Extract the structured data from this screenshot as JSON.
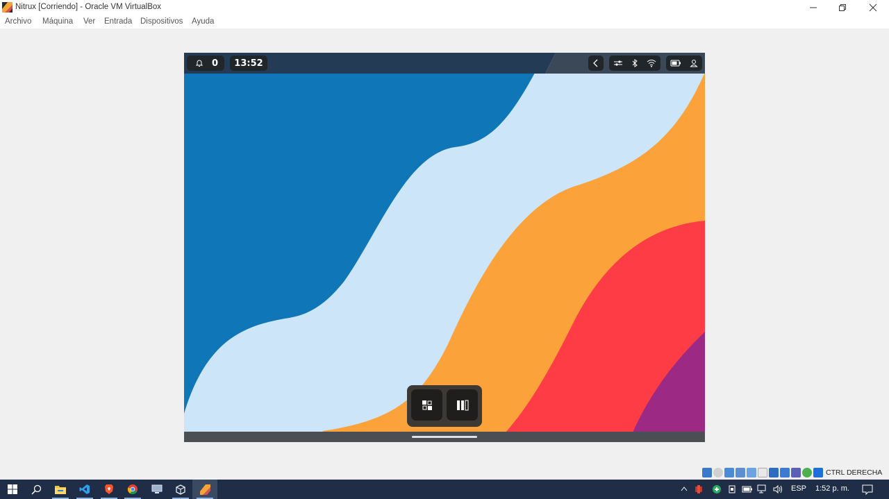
{
  "window": {
    "title": "Nitrux [Corriendo] - Oracle VM VirtualBox",
    "controls": [
      "minimize",
      "restore",
      "close"
    ]
  },
  "menu": {
    "items": [
      "Archivo",
      "Máquina",
      "Ver",
      "Entrada",
      "Dispositivos",
      "Ayuda"
    ]
  },
  "vm": {
    "notifications_count": "0",
    "clock": "13:52",
    "icons": [
      "bell-icon",
      "chevron-left-icon",
      "toggles-icon",
      "bluetooth-icon",
      "wifi-icon",
      "battery-icon",
      "user-icon"
    ],
    "dock": [
      "overview-icon",
      "columns-icon"
    ],
    "wallpaper_colors": {
      "blue": "#0f76b7",
      "light_blue": "#cde5f8",
      "orange": "#fba23a",
      "red": "#fd3c45",
      "purple": "#9c2a85"
    }
  },
  "vbox_status": {
    "host_key": "CTRL DERECHA"
  },
  "taskbar": {
    "apps": [
      "windows-start-icon",
      "search-icon",
      "file-explorer-icon",
      "vscode-icon",
      "brave-icon",
      "chrome-icon",
      "remote-desktop-icon",
      "virtualbox-icon",
      "nitrux-vm-icon"
    ],
    "lang": "ESP",
    "time": "1:52 p. m."
  }
}
